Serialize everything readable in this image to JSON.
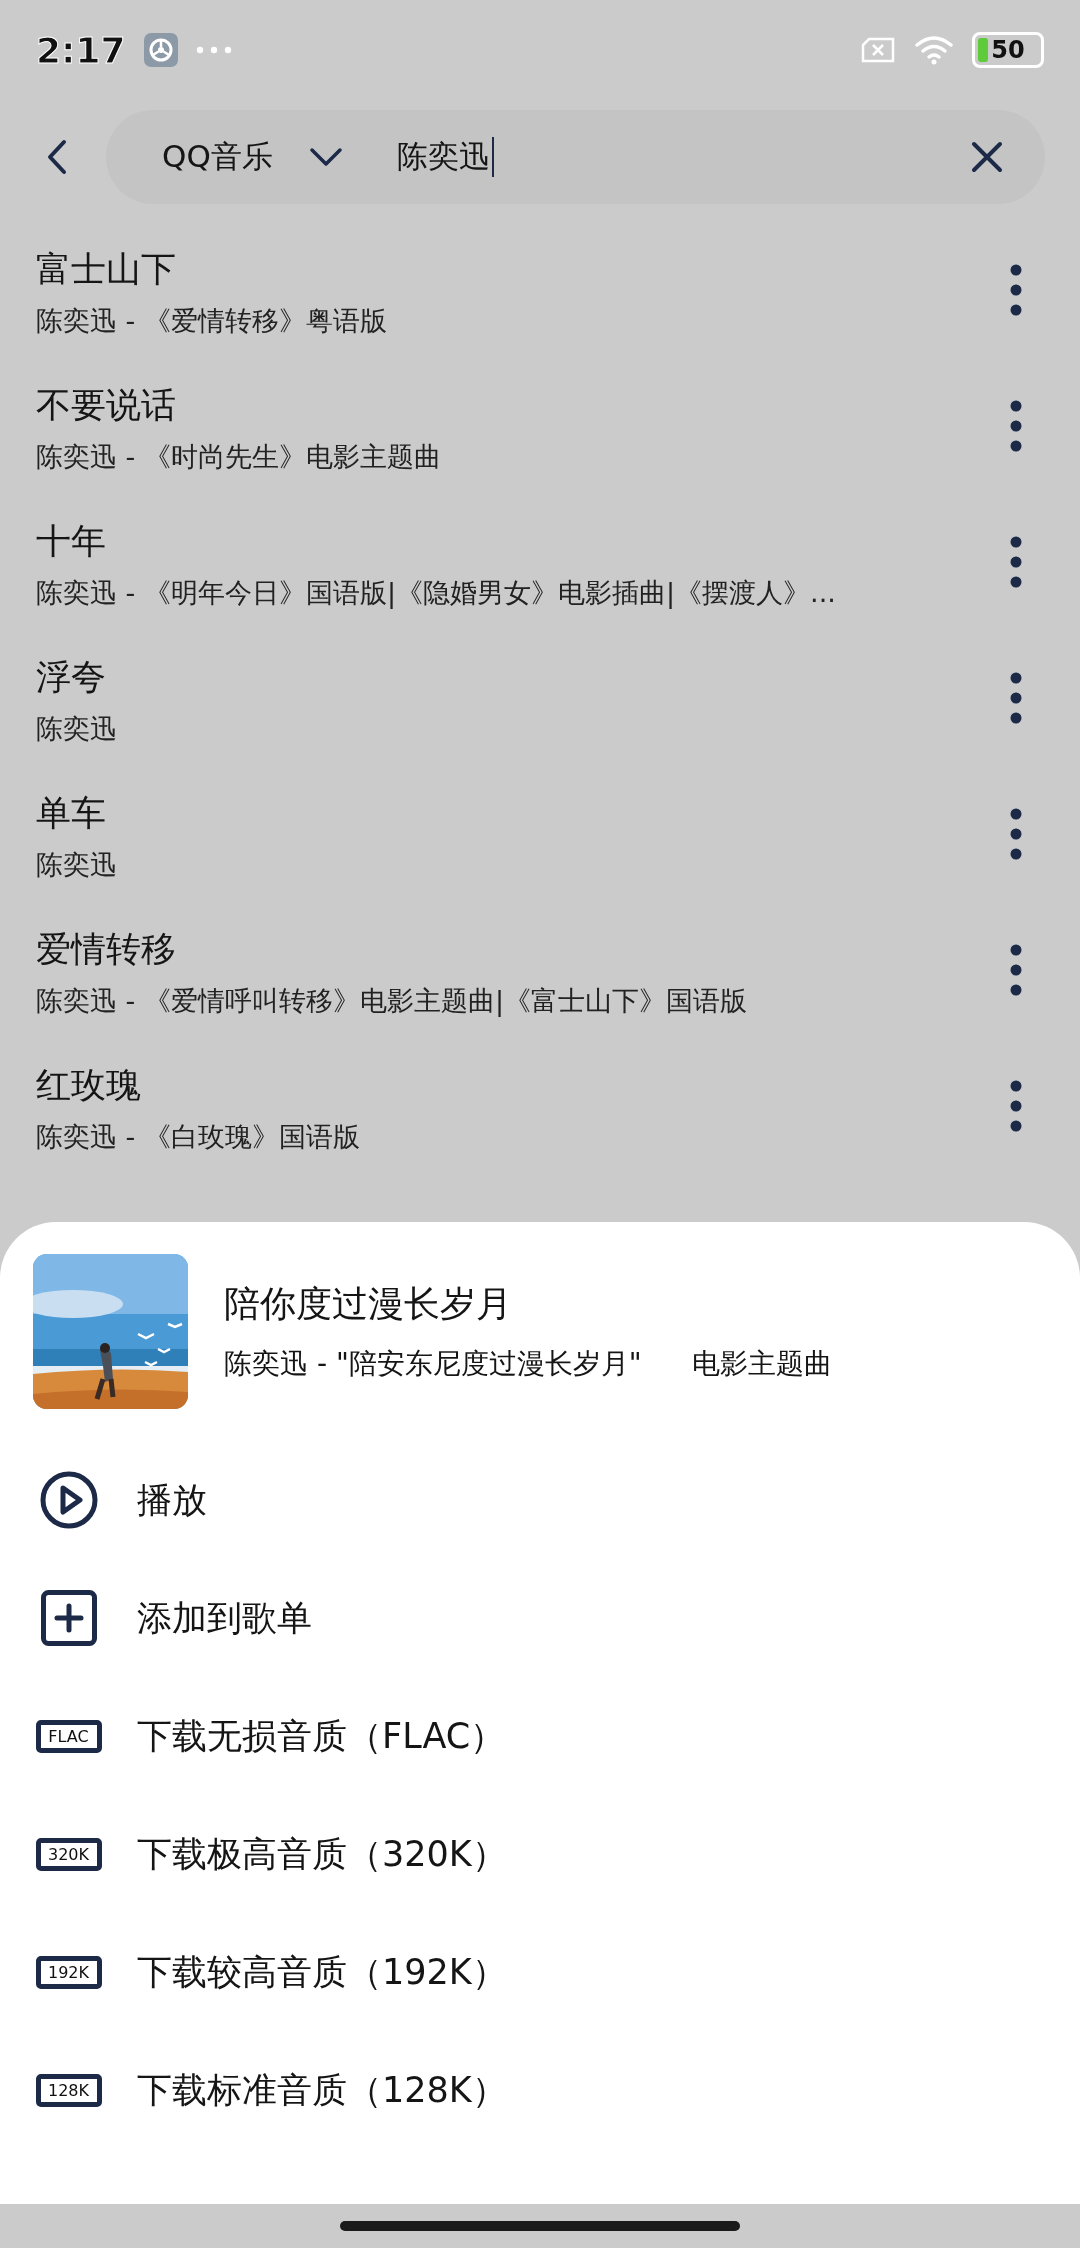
{
  "status_bar": {
    "time": "2:17",
    "battery": "50"
  },
  "search": {
    "source": "QQ音乐",
    "value": "陈奕迅"
  },
  "results": [
    {
      "title": "富士山下",
      "subtitle": "陈奕迅 - 《爱情转移》粤语版"
    },
    {
      "title": "不要说话",
      "subtitle": "陈奕迅 - 《时尚先生》电影主题曲"
    },
    {
      "title": "十年",
      "subtitle": "陈奕迅 - 《明年今日》国语版|《隐婚男女》电影插曲|《摆渡人》..."
    },
    {
      "title": "浮夸",
      "subtitle": "陈奕迅"
    },
    {
      "title": "单车",
      "subtitle": "陈奕迅"
    },
    {
      "title": "爱情转移",
      "subtitle": "陈奕迅 - 《爱情呼叫转移》电影主题曲|《富士山下》国语版"
    },
    {
      "title": "红玫瑰",
      "subtitle": "陈奕迅 - 《白玫瑰》国语版"
    }
  ],
  "sheet": {
    "song": {
      "title": "陪你度过漫长岁月",
      "artist_line": "陈奕迅 - \"陪安东尼度过漫长岁月\"",
      "note": "电影主题曲"
    },
    "actions": [
      {
        "kind": "play",
        "label": "播放"
      },
      {
        "kind": "add",
        "label": "添加到歌单"
      },
      {
        "kind": "quality",
        "badge": "FLAC",
        "label": "下载无损音质（FLAC）"
      },
      {
        "kind": "quality",
        "badge": "320K",
        "label": "下载极高音质（320K）"
      },
      {
        "kind": "quality",
        "badge": "192K",
        "label": "下载较高音质（192K）"
      },
      {
        "kind": "quality",
        "badge": "128K",
        "label": "下载标准音质（128K）"
      }
    ]
  }
}
